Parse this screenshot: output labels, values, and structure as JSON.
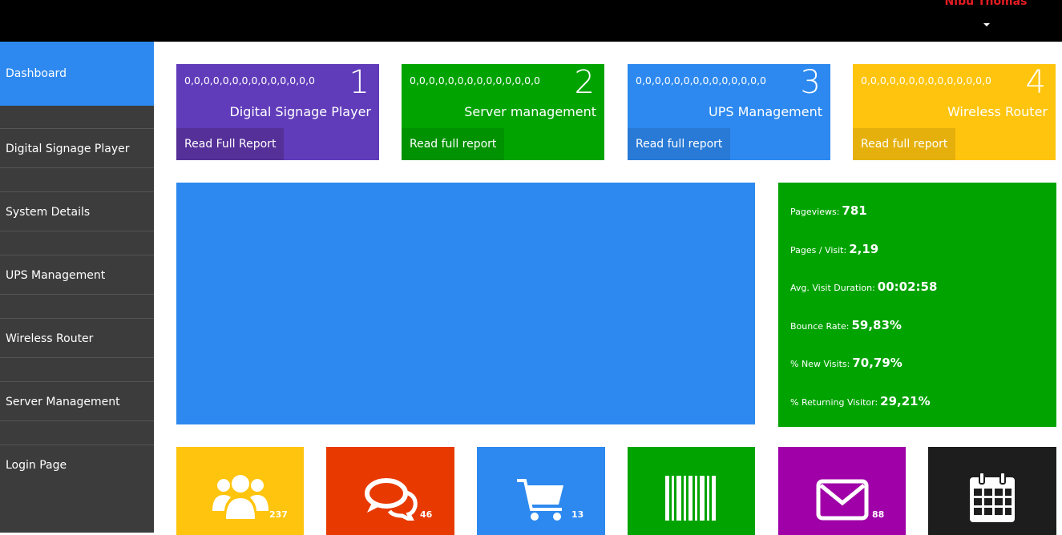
{
  "header": {
    "user_name": "Nibu Thomas"
  },
  "sidebar": {
    "items": [
      {
        "label": "Dashboard"
      },
      {
        "label": "Digital Signage Player"
      },
      {
        "label": "System Details"
      },
      {
        "label": "UPS Management"
      },
      {
        "label": "Wireless Router"
      },
      {
        "label": "Server Management"
      },
      {
        "label": "Login Page"
      }
    ]
  },
  "tiles": [
    {
      "zeros": "0,0,0,0,0,0,0,0,0,0,0,0,0,0",
      "number": "1",
      "title": "Digital Signage Player",
      "link": "Read Full Report",
      "color": "#603cba"
    },
    {
      "zeros": "0,0,0,0,0,0,0,0,0,0,0,0,0,0",
      "number": "2",
      "title": "Server management",
      "link": "Read full report",
      "color": "#00a300"
    },
    {
      "zeros": "0,0,0,0,0,0,0,0,0,0,0,0,0,0",
      "number": "3",
      "title": "UPS Management",
      "link": "Read full report",
      "color": "#2d89ef"
    },
    {
      "zeros": "0,0,0,0,0,0,0,0,0,0,0,0,0,0",
      "number": "4",
      "title": "Wireless Router",
      "link": "Read full report",
      "color": "#ffc40d"
    }
  ],
  "stats": [
    {
      "label": "Pageviews:",
      "value": "781"
    },
    {
      "label": "Pages / Visit:",
      "value": "2,19"
    },
    {
      "label": "Avg. Visit Duration:",
      "value": "00:02:58"
    },
    {
      "label": "Bounce Rate:",
      "value": "59,83%"
    },
    {
      "label": "% New Visits:",
      "value": "70,79%"
    },
    {
      "label": "% Returning Visitor:",
      "value": "29,21%"
    }
  ],
  "bottom_tiles": [
    {
      "icon": "users-icon",
      "count": "237",
      "color": "#ffc40d"
    },
    {
      "icon": "chat-icon",
      "count": "46",
      "color": "#e83a00"
    },
    {
      "icon": "cart-icon",
      "count": "13",
      "color": "#2d89ef"
    },
    {
      "icon": "barcode-icon",
      "count": "",
      "color": "#00a300"
    },
    {
      "icon": "mail-icon",
      "count": "88",
      "color": "#9f00a7"
    },
    {
      "icon": "calendar-icon",
      "count": "",
      "color": "#1d1d1d"
    }
  ]
}
